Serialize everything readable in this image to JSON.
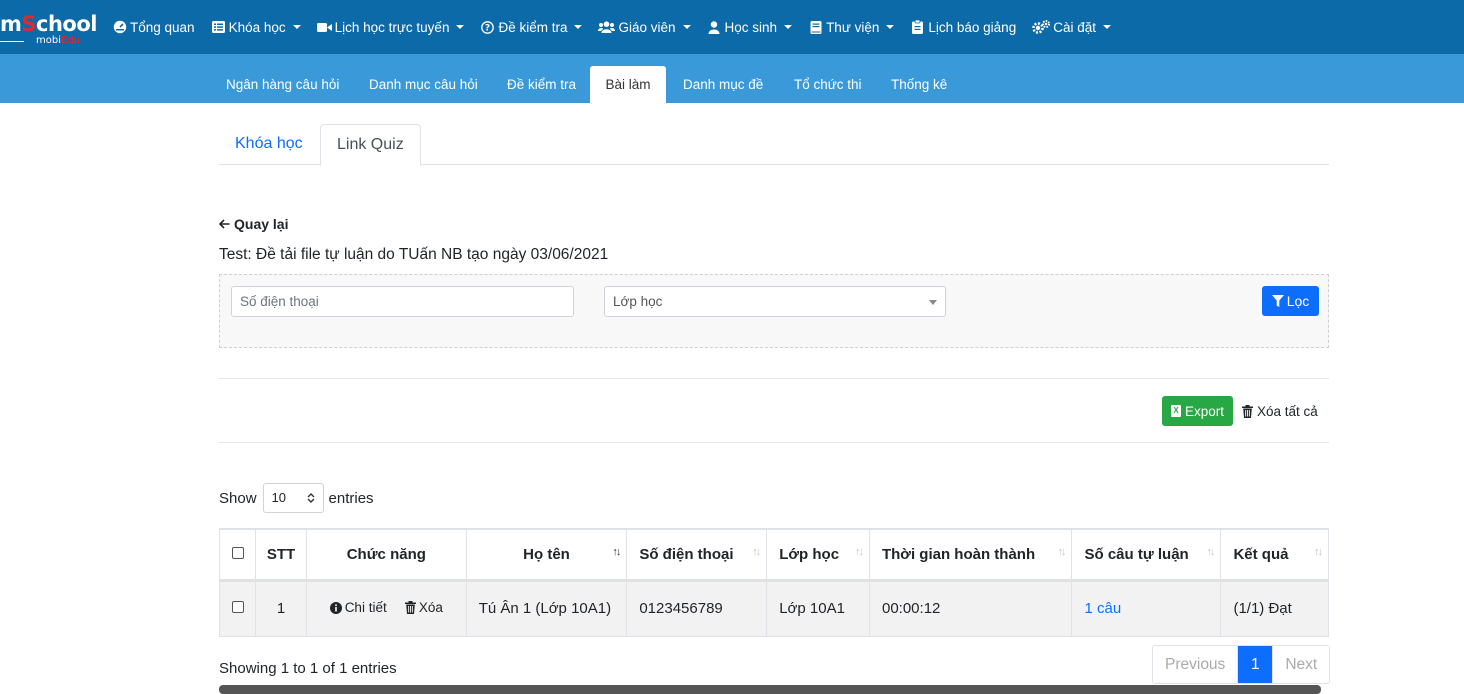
{
  "brand": {
    "logo_main_prefix": "m",
    "logo_main_s": "S",
    "logo_main_rest": "chool",
    "logo_sub_prefix": "mobi",
    "logo_sub_accent": "Edu"
  },
  "topnav": {
    "items": [
      {
        "label": "Tổng quan",
        "icon": "dashboard-icon",
        "dropdown": false
      },
      {
        "label": "Khóa học",
        "icon": "list-icon",
        "dropdown": true
      },
      {
        "label": "Lịch học trực tuyến",
        "icon": "video-icon",
        "dropdown": true
      },
      {
        "label": "Đề kiểm tra",
        "icon": "question-icon",
        "dropdown": true
      },
      {
        "label": "Giáo viên",
        "icon": "users-icon",
        "dropdown": true
      },
      {
        "label": "Học sinh",
        "icon": "user-icon",
        "dropdown": true
      },
      {
        "label": "Thư viện",
        "icon": "book-icon",
        "dropdown": true
      },
      {
        "label": "Lịch báo giảng",
        "icon": "clipboard-icon",
        "dropdown": false
      },
      {
        "label": "Cài đặt",
        "icon": "cogs-icon",
        "dropdown": true
      }
    ]
  },
  "subnav": {
    "items": [
      "Ngân hàng câu hỏi",
      "Danh mục câu hỏi",
      "Đề kiểm tra",
      "Bài làm",
      "Danh mục đề",
      "Tổ chức thi",
      "Thống kê"
    ],
    "active": "Bài làm"
  },
  "content_tabs": {
    "course": "Khóa học",
    "link_quiz": "Link Quiz",
    "active": "Link Quiz"
  },
  "back_label": "Quay lại",
  "test_title": "Test: Đề tải file tự luận do TUấn NB tạo ngày 03/06/2021",
  "filter": {
    "phone_placeholder": "Số điện thoại",
    "class_value": "Lớp học",
    "filter_button": "Lọc"
  },
  "actions": {
    "export": "Export",
    "delete_all": "Xóa tất cả"
  },
  "length": {
    "show": "Show",
    "value": "10",
    "entries": "entries"
  },
  "table": {
    "headers": {
      "stt": "STT",
      "function": "Chức năng",
      "name": "Họ tên",
      "phone": "Số điện thoại",
      "class": "Lớp học",
      "duration": "Thời gian hoàn thành",
      "essay": "Số câu tự luận",
      "result": "Kết quả"
    },
    "rows": [
      {
        "stt": "1",
        "detail": "Chi tiết",
        "delete": "Xóa",
        "name": "Tú Ân 1 (Lớp 10A1)",
        "phone": "0123456789",
        "class": "Lớp 10A1",
        "duration": "00:00:12",
        "essay": "1 câu",
        "result": "(1/1) Đạt"
      }
    ]
  },
  "info": "Showing 1 to 1 of 1 entries",
  "pagination": {
    "previous": "Previous",
    "current": "1",
    "next": "Next"
  },
  "colors": {
    "topnav": "#0d6aa8",
    "subnav": "#3a9ad9",
    "primary": "#0d6efd",
    "success": "#28a745"
  }
}
